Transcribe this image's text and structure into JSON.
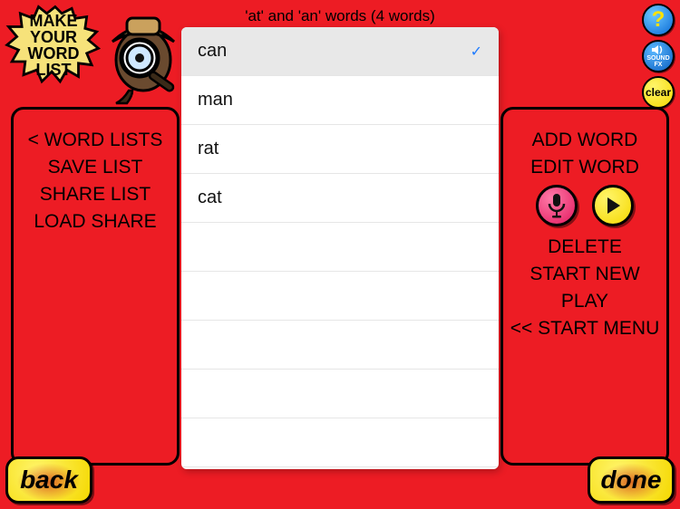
{
  "badge": {
    "line1": "MAKE",
    "line2": "YOUR",
    "line3": "WORD",
    "line4": "LIST"
  },
  "title": "'at' and 'an' words (4 words)",
  "words": [
    {
      "text": "can",
      "selected": true
    },
    {
      "text": "man",
      "selected": false
    },
    {
      "text": "rat",
      "selected": false
    },
    {
      "text": "cat",
      "selected": false
    }
  ],
  "blank_rows": 5,
  "left_menu": {
    "word_lists": "< WORD LISTS",
    "save_list": "SAVE LIST",
    "share_list": "SHARE LIST",
    "load_share": "LOAD SHARE"
  },
  "right_menu": {
    "add_word": "ADD WORD",
    "edit_word": "EDIT WORD",
    "delete": "DELETE",
    "start_new": "START NEW",
    "play": "PLAY",
    "start_menu": "<< START MENU"
  },
  "buttons": {
    "back": "back",
    "done": "done",
    "help": "?",
    "sound_top": "SOUND",
    "sound_bottom": "FX",
    "clear": "clear"
  },
  "colors": {
    "bg": "#ed1c24",
    "yellow": "#f5d800",
    "blue": "#0a6ad6",
    "pink": "#e21a5f"
  }
}
